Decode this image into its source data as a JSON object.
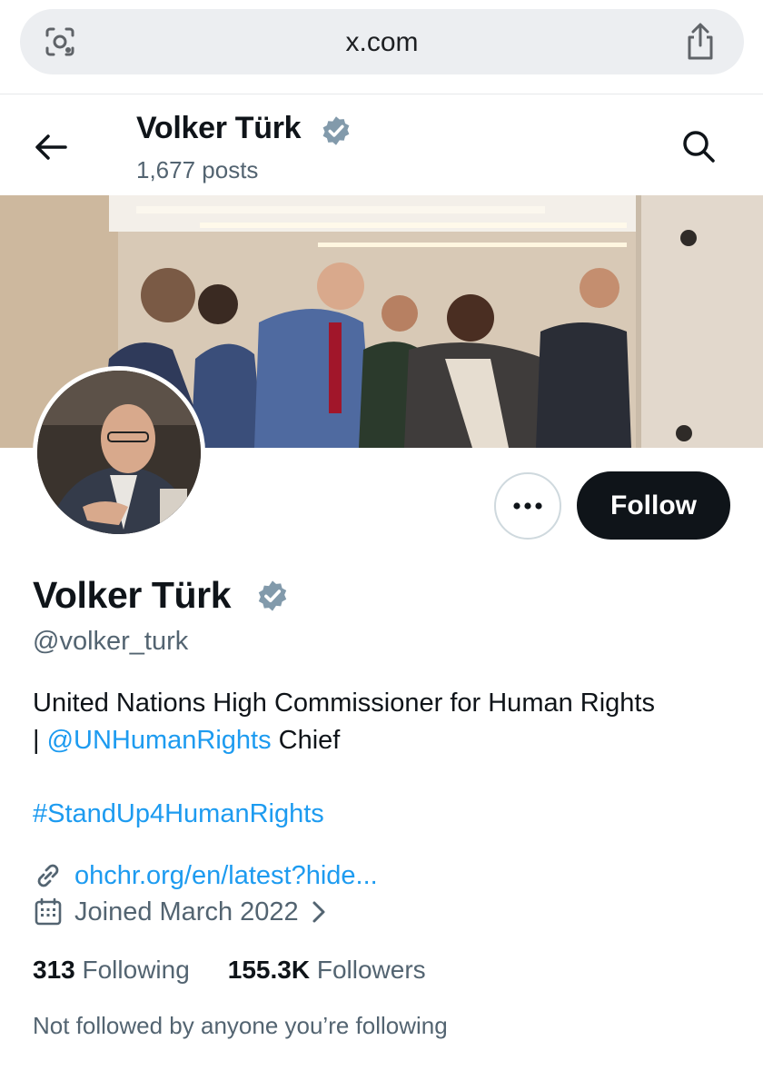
{
  "browser": {
    "url": "x.com"
  },
  "header": {
    "name": "Volker Türk",
    "posts": "1,677 posts"
  },
  "profile": {
    "name": "Volker Türk",
    "handle": "@volker_turk",
    "bio_line1": "United Nations High Commissioner for Human Rights",
    "bio_separator": "| ",
    "bio_mention": "@UNHumanRights",
    "bio_suffix": " Chief",
    "hashtag": "#StandUp4HumanRights",
    "website": "ohchr.org/en/latest?hide...",
    "joined": "Joined March 2022"
  },
  "actions": {
    "follow_label": "Follow",
    "more_label": "•••"
  },
  "stats": {
    "following_count": "313",
    "following_label": "Following",
    "followers_count": "155.3K",
    "followers_label": "Followers"
  },
  "social_context": "Not followed by anyone you’re following",
  "colors": {
    "accent": "#1d9bf0",
    "button_dark": "#0f1419",
    "muted": "#536471",
    "verified": "#829aab"
  },
  "icons": [
    "lens-icon",
    "share-icon",
    "back-arrow-icon",
    "verified-badge-icon",
    "search-icon",
    "more-icon",
    "link-icon",
    "calendar-icon",
    "chevron-right-icon"
  ]
}
